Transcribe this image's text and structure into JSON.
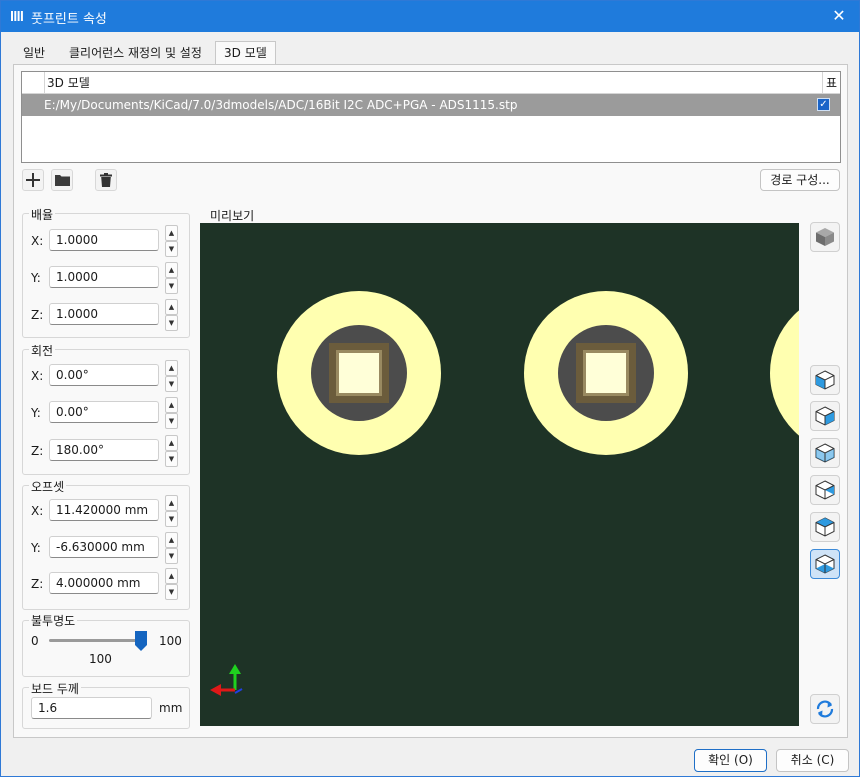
{
  "window": {
    "title": "풋프린트 속성",
    "close_glyph": "✕"
  },
  "tabs": [
    {
      "label": "일반"
    },
    {
      "label": "클리어런스 재정의 및 설정"
    },
    {
      "label": "3D 모델"
    }
  ],
  "models_table": {
    "col_model": "3D 모델",
    "col_show": "표시",
    "rows": [
      {
        "path": "E:/My/Documents/KiCad/7.0/3dmodels/ADC/16Bit I2C ADC+PGA - ADS1115.stp",
        "show": true
      }
    ]
  },
  "toolbar": {
    "add_icon": "plus-icon",
    "folder_icon": "folder-icon",
    "delete_icon": "trash-icon",
    "configure_paths_label": "경로 구성..."
  },
  "scale": {
    "title": "배율",
    "x_label": "X:",
    "x_value": "1.0000",
    "y_label": "Y:",
    "y_value": "1.0000",
    "z_label": "Z:",
    "z_value": "1.0000"
  },
  "rotation": {
    "title": "회전",
    "x_label": "X:",
    "x_value": "0.00°",
    "y_label": "Y:",
    "y_value": "0.00°",
    "z_label": "Z:",
    "z_value": "180.00°"
  },
  "offset": {
    "title": "오프셋",
    "x_label": "X:",
    "x_value": "11.420000 mm",
    "y_label": "Y:",
    "y_value": "-6.630000 mm",
    "z_label": "Z:",
    "z_value": "4.000000 mm"
  },
  "opacity": {
    "title": "불투명도",
    "min_label": "0",
    "max_label": "100",
    "value_label": "100",
    "value": 100
  },
  "board_thickness": {
    "title": "보드 두께",
    "value": "1.6",
    "unit": "mm"
  },
  "preview": {
    "title": "미리보기",
    "board_color": "#1e3326",
    "pad_color": "#ffffb0"
  },
  "footer": {
    "ok_label": "확인 (O)",
    "cancel_label": "취소 (C)"
  }
}
